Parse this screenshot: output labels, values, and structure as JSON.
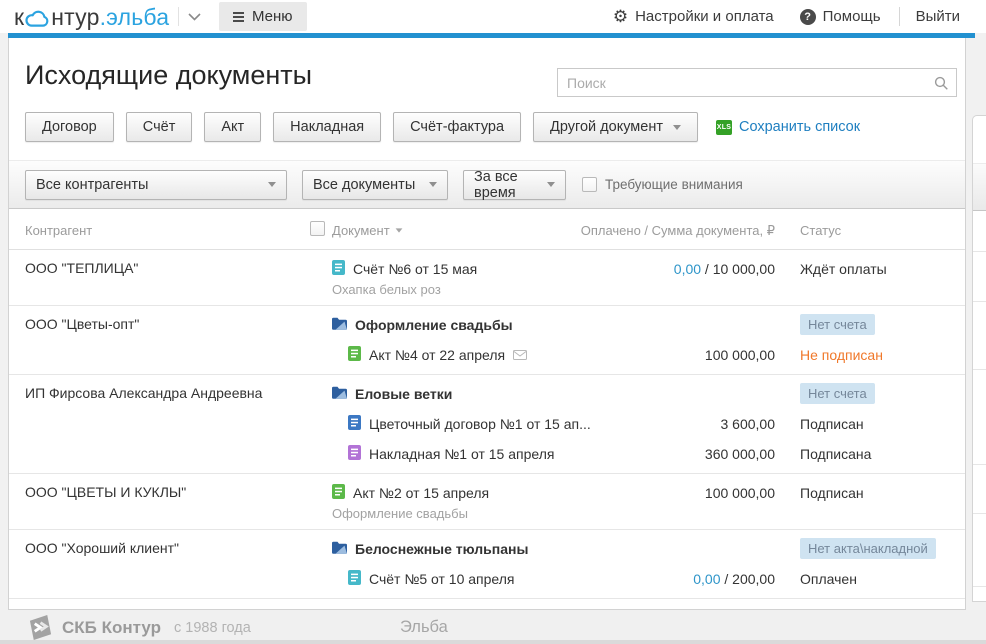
{
  "header": {
    "logo": {
      "k": "к",
      "ntur": "нтур",
      "elba": ".эльба"
    },
    "menu_label": "Меню",
    "settings_label": "Настройки и оплата",
    "help_label": "Помощь",
    "logout_label": "Выйти"
  },
  "page": {
    "title": "Исходящие документы",
    "search_placeholder": "Поиск"
  },
  "doc_type_buttons": [
    "Договор",
    "Счёт",
    "Акт",
    "Накладная",
    "Счёт-фактура"
  ],
  "other_doc_label": "Другой документ",
  "save_list_label": "Сохранить список",
  "filters": {
    "counterparties": "Все контрагенты",
    "documents": "Все документы",
    "period": "За все время",
    "attention": "Требующие внимания"
  },
  "table": {
    "headers": {
      "counterparty": "Контрагент",
      "document": "Документ",
      "amount": "Оплачено / Сумма документа, ₽",
      "status": "Статус"
    },
    "rows": [
      {
        "counterparty": "ООО \"ТЕПЛИЦА\"",
        "lines": [
          {
            "kind": "doc",
            "icon": "invoice-doc-icon",
            "color": "doc_invoice",
            "indent": false,
            "title": "Счёт №6 от 15 мая",
            "subtitle": "Охапка белых роз",
            "paid": "0,00",
            "total": "10 000,00",
            "status": "Ждёт оплаты",
            "status_type": "normal"
          }
        ]
      },
      {
        "counterparty": "ООО \"Цветы-опт\"",
        "lines": [
          {
            "kind": "group",
            "icon": "folder-icon",
            "title": "Оформление свадьбы",
            "badge": "Нет счета"
          },
          {
            "kind": "doc",
            "icon": "act-doc-icon",
            "color": "doc_act",
            "indent": true,
            "title": "Акт №4 от 22 апреля",
            "envelope": true,
            "total": "100 000,00",
            "status": "Не подписан",
            "status_type": "warning"
          }
        ]
      },
      {
        "counterparty": "ИП Фирсова Александра Андреевна",
        "lines": [
          {
            "kind": "group",
            "icon": "folder-icon",
            "title": "Еловые ветки",
            "badge": "Нет счета"
          },
          {
            "kind": "doc",
            "icon": "contract-doc-icon",
            "color": "doc_contract",
            "indent": true,
            "title": "Цветочный договор №1 от 15 ап...",
            "total": "3 600,00",
            "status": "Подписан",
            "status_type": "normal"
          },
          {
            "kind": "doc",
            "icon": "waybill-doc-icon",
            "color": "doc_waybill",
            "indent": true,
            "title": "Накладная №1 от 15 апреля",
            "total": "360 000,00",
            "status": "Подписана",
            "status_type": "normal"
          }
        ]
      },
      {
        "counterparty": "ООО \"ЦВЕТЫ И КУКЛЫ\"",
        "lines": [
          {
            "kind": "doc",
            "icon": "act-doc-icon",
            "color": "doc_act",
            "indent": false,
            "title": "Акт №2 от 15 апреля",
            "subtitle": "Оформление свадьбы",
            "total": "100 000,00",
            "status": "Подписан",
            "status_type": "normal"
          }
        ]
      },
      {
        "counterparty": "ООО \"Хороший клиент\"",
        "lines": [
          {
            "kind": "group",
            "icon": "folder-icon",
            "title": "Белоснежные тюльпаны",
            "badge": "Нет акта\\накладной"
          },
          {
            "kind": "doc",
            "icon": "invoice-doc-icon",
            "color": "doc_invoice",
            "indent": true,
            "title": "Счёт №5 от 10 апреля",
            "paid": "0,00",
            "total": "200,00",
            "status": "Оплачен",
            "status_type": "normal"
          }
        ]
      }
    ]
  },
  "footer": {
    "brand": "СКБ Контур",
    "since": "с 1988 года",
    "product": "Эльба"
  },
  "colors": {
    "accent_blue": "#2291d0",
    "logo_blue": "#2ba3e0",
    "link_blue": "#1f7fc0",
    "paid_blue": "#2e95c9",
    "warning_orange": "#f0782a",
    "badge_bg": "#cfe3f1",
    "badge_text": "#75879a",
    "doc_invoice": "#45b8c9",
    "doc_act": "#5cb949",
    "doc_contract": "#3c78c3",
    "doc_waybill": "#b273d6",
    "folder_blue": "#2d5f9f"
  }
}
